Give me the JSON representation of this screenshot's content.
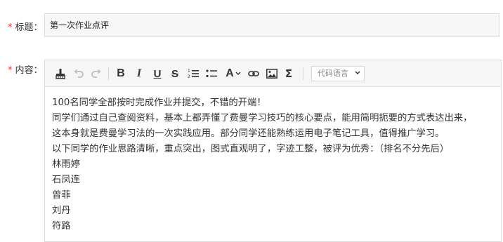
{
  "form": {
    "title": {
      "label": "标题：",
      "required_mark": "*",
      "value": "第一次作业点评"
    },
    "content": {
      "label": "内容：",
      "required_mark": "*"
    }
  },
  "toolbar": {
    "buttons": [
      "clear-format-icon",
      "undo-icon",
      "redo-icon",
      "bold-icon",
      "italic-icon",
      "underline-icon",
      "strikethrough-icon",
      "ordered-list-icon",
      "unordered-list-icon",
      "font-color-icon",
      "link-icon",
      "image-icon",
      "formula-icon"
    ],
    "bold_label": "B",
    "italic_label": "I",
    "underline_label": "U",
    "strike_label": "S",
    "font_color_label": "A",
    "formula_label": "Σ",
    "code_language": "代码语言"
  },
  "editor": {
    "lines": [
      "100名同学全部按时完成作业并提交，不错的开端！",
      "同学们通过自己查阅资料，基本上都弄懂了费曼学习技巧的核心要点，能用简明扼要的方式表达出来，",
      "这本身就是费曼学习法的一次实践应用。部分同学还能熟练运用电子笔记工具，值得推广学习。",
      "以下同学的作业思路清晰，重点突出，图式直观明了，字迹工整，被评为优秀：（排名不分先后）",
      "林雨婷",
      "石凤连",
      "曾菲",
      "刘丹",
      "符路"
    ]
  },
  "colors": {
    "required": "#e53935",
    "border": "#dcdcdc",
    "toolbar_bg": "#f6f6f6",
    "disabled_icon": "#bdbdbd"
  }
}
